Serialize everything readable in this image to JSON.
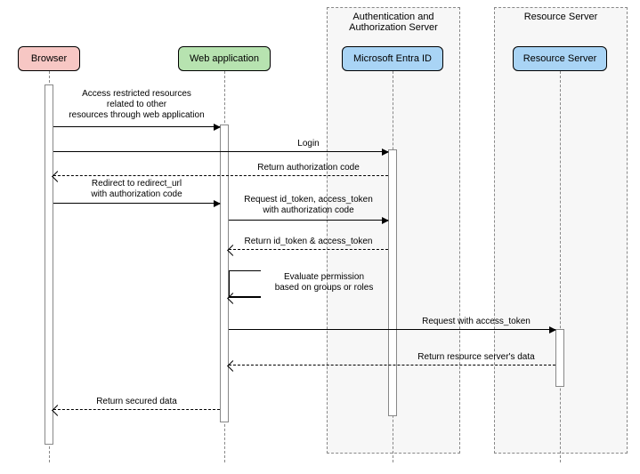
{
  "participants": {
    "browser": {
      "label": "Browser",
      "color": "#F7C7C4"
    },
    "webapp": {
      "label": "Web application",
      "color": "#B7E3B0"
    },
    "entra": {
      "label": "Microsoft Entra ID",
      "color": "#A9D4F5"
    },
    "resource": {
      "label": "Resource Server",
      "color": "#A9D4F5"
    }
  },
  "containers": {
    "auth": {
      "title": "Authentication and\nAuthorization Server"
    },
    "resource": {
      "title": "Resource Server"
    }
  },
  "messages": {
    "m1": "Access restricted resources\nrelated to other\nresources through web application",
    "m2": "Login",
    "m3": "Return authorization code",
    "m4": "Redirect to redirect_url\nwith authorization code",
    "m5": "Request id_token, access_token\nwith authorization code",
    "m6": "Return id_token & access_token",
    "m7": "Evaluate permission\nbased on groups or roles",
    "m8": "Request with access_token",
    "m9": "Return resource server's data",
    "m10": "Return secured data"
  }
}
